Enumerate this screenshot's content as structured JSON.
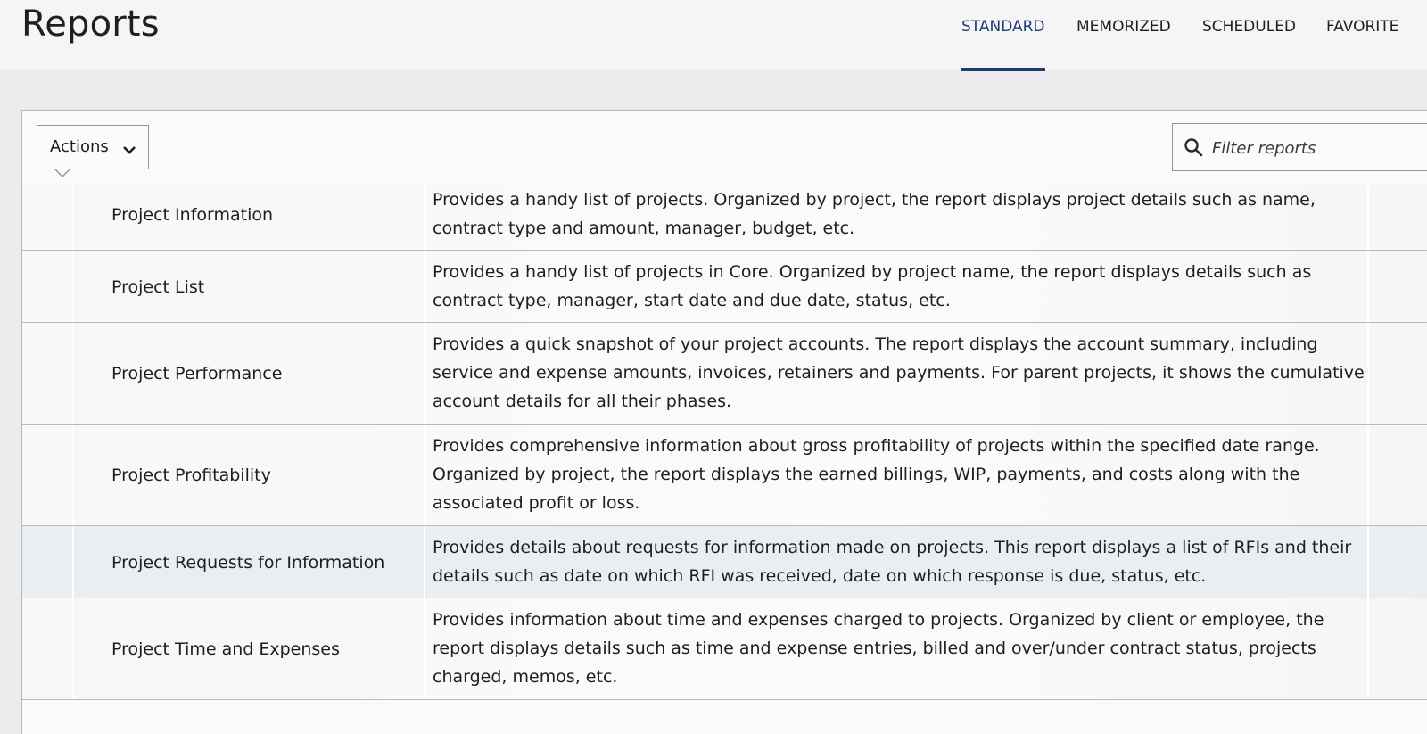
{
  "header": {
    "title": "Reports",
    "tabs": [
      {
        "label": "STANDARD",
        "active": true
      },
      {
        "label": "MEMORIZED",
        "active": false
      },
      {
        "label": "SCHEDULED",
        "active": false
      },
      {
        "label": "FAVORITE",
        "active": false
      }
    ]
  },
  "toolbar": {
    "actions_label": "Actions",
    "filter_placeholder": "Filter reports"
  },
  "reports": [
    {
      "name": "Project Information",
      "description": "Provides a handy list of projects. Organized by project, the report displays project details such as name, contract type and amount, manager, budget, etc."
    },
    {
      "name": "Project List",
      "description": "Provides a handy list of projects in Core. Organized by project name, the report displays details such as contract type, manager, start date and due date, status, etc."
    },
    {
      "name": "Project Performance",
      "description": "Provides a quick snapshot of your project accounts. The report displays the account summary, including service and expense amounts, invoices, retainers and payments. For parent projects, it shows the cumulative account details for all their phases."
    },
    {
      "name": "Project Profitability",
      "description": "Provides comprehensive information about gross profitability of projects within the specified date range. Organized by project, the report displays the earned billings, WIP, payments, and costs along with the associated profit or loss."
    },
    {
      "name": "Project Requests for Information",
      "description": "Provides details about requests for information made on projects. This report displays a list of RFIs and their details such as date on which RFI was received, date on which response is due, status, etc.",
      "highlighted": true
    },
    {
      "name": "Project Time and Expenses",
      "description": "Provides information about time and expenses charged to projects. Organized by client or employee, the report displays details such as time and expense entries, billed and over/under contract status, projects charged, memos, etc."
    }
  ],
  "colors": {
    "accent": "#1f3a78",
    "row_highlight": "#e9eef3",
    "border": "#b6bcc2"
  }
}
